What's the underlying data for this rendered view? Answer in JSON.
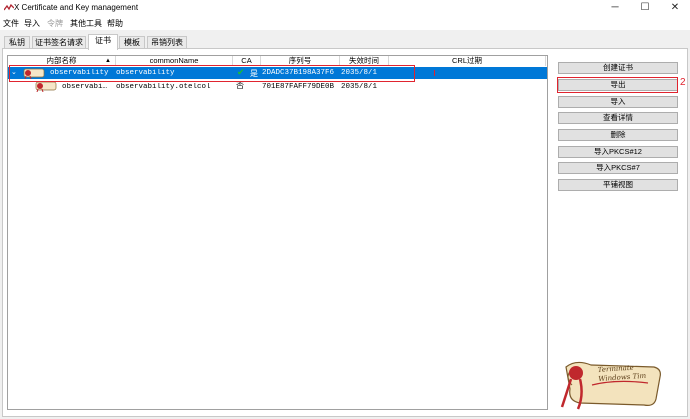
{
  "window": {
    "title": "X Certificate and Key management"
  },
  "menu": [
    "文件",
    "导入",
    "令牌",
    "其他工具",
    "帮助"
  ],
  "tabs": [
    "私钥",
    "证书签名请求",
    "证书",
    "模板",
    "吊销列表"
  ],
  "columns": [
    "内部名称",
    "commonName",
    "CA",
    "序列号",
    "失效时间",
    "CRL过期"
  ],
  "rows": [
    {
      "name": "observability",
      "cn": "observability",
      "ca": "是",
      "serial": "2DADC37B198A37F6",
      "expiry": "2035/8/1",
      "crl": ""
    },
    {
      "name": "observabi…",
      "cn": "observability.otelcol",
      "ca": "否",
      "serial": "701E87FAFF79DE0B",
      "expiry": "2035/8/1",
      "crl": ""
    }
  ],
  "buttons": [
    "创建证书",
    "导出",
    "导入",
    "查看详情",
    "删除",
    "导入PKCS#12",
    "导入PKCS#7",
    "平铺视图"
  ],
  "annotation": "2",
  "logo": {
    "text": "Terminate Windows Tim"
  },
  "colors": {
    "selection": "#0078d7",
    "annotation": "#e0242f"
  }
}
